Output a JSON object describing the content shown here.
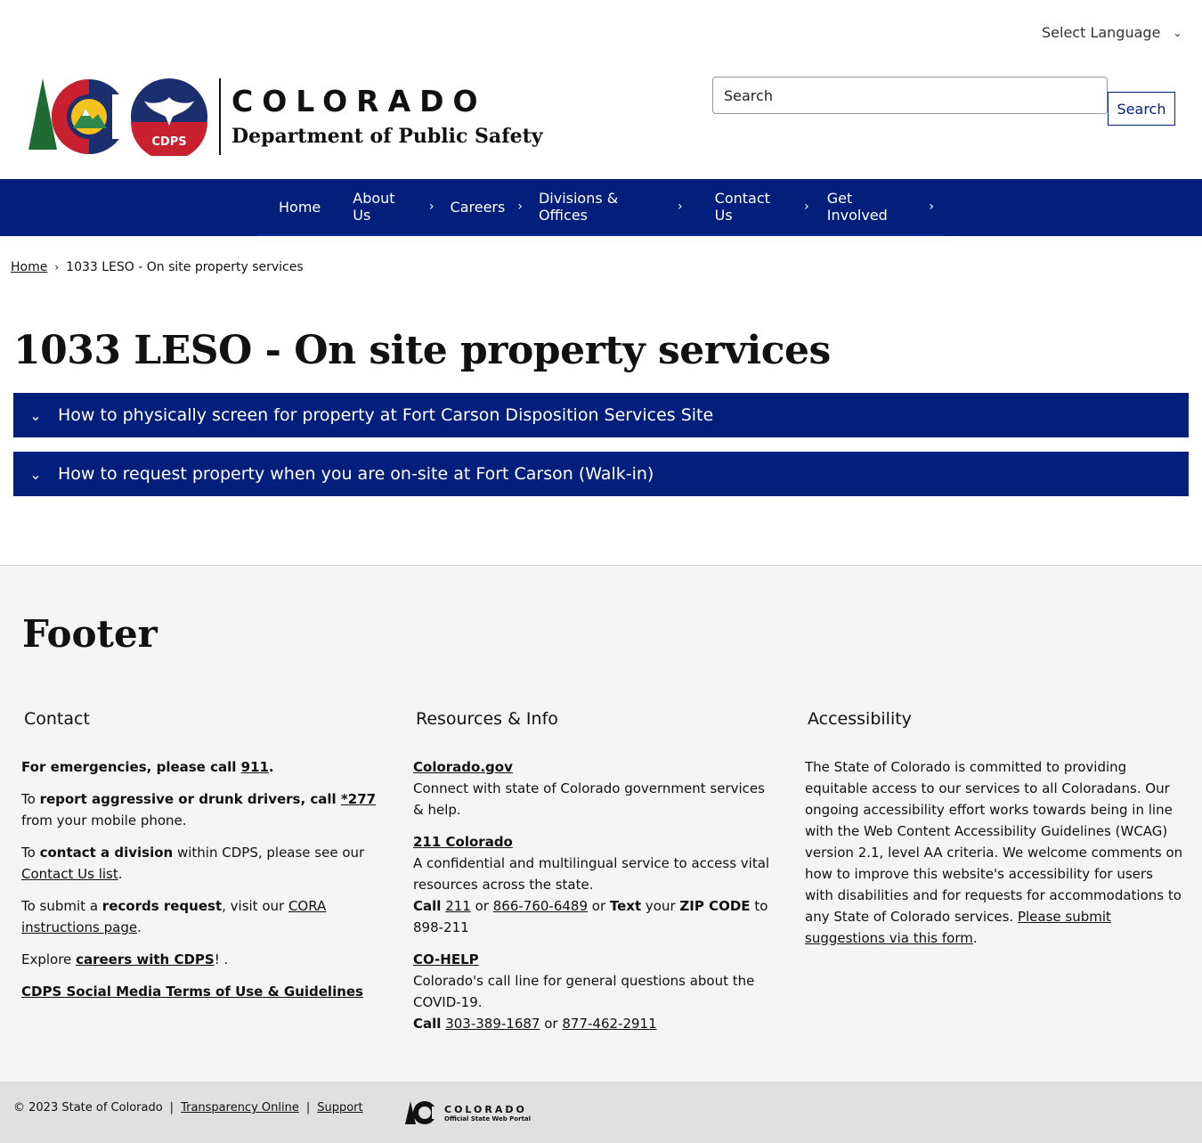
{
  "language": {
    "label": "Select Language"
  },
  "header": {
    "brand_top": "COLORADO",
    "brand_bottom": "Department of Public Safety",
    "seal_text": "CDPS",
    "search_placeholder": "Search",
    "search_button": "Search"
  },
  "nav": {
    "items": [
      {
        "label": "Home"
      },
      {
        "label": "About Us"
      },
      {
        "label": "Careers"
      },
      {
        "label": "Divisions & Offices"
      },
      {
        "label": "Contact Us"
      },
      {
        "label": "Get Involved"
      }
    ]
  },
  "breadcrumb": {
    "home": "Home",
    "current": "1033 LESO - On site property services"
  },
  "page": {
    "title": "1033 LESO - On site property services",
    "accordions": [
      {
        "label": "How to physically screen for property at Fort Carson Disposition Services Site"
      },
      {
        "label": "How to request property when you are on-site at Fort Carson (Walk-in)"
      }
    ]
  },
  "footer": {
    "heading": "Footer",
    "contact": {
      "heading": "Contact",
      "emergency_a": "For emergencies, please call ",
      "emergency_link": "911",
      "emergency_b": ".",
      "drivers_a": "To ",
      "drivers_bold": "report aggressive or drunk drivers, call ",
      "drivers_link": "*277",
      "drivers_b": " from your mobile phone.",
      "division_a": "To ",
      "division_bold": "contact a division",
      "division_b": " within CDPS, please see our ",
      "division_link": "Contact Us list",
      "division_c": ".",
      "records_a": "To submit a ",
      "records_bold": "records request",
      "records_b": ", visit our ",
      "records_link": "CORA instructions page",
      "records_c": ".",
      "careers_a": "Explore ",
      "careers_link": "careers with CDPS",
      "careers_b": "! .",
      "social_link": "CDPS Social Media Terms of Use & Guidelines"
    },
    "resources": {
      "heading": "Resources & Info",
      "co_link": "Colorado.gov",
      "co_desc": "Connect with state of Colorado government services & help.",
      "r211_link": "211 Colorado",
      "r211_desc": "A confidential and multilingual service to access vital resources across the state.",
      "r211_call": "Call",
      "r211_num1": "211",
      "r211_or1": " or ",
      "r211_num2": "866-760-6489",
      "r211_or2": " or ",
      "r211_text": "Text",
      "r211_your": " your ",
      "r211_zip": "ZIP CODE",
      "r211_to": " to 898-211",
      "cohelp_link": "CO-HELP",
      "cohelp_desc": "Colorado's call line for general questions about the COVID-19.",
      "cohelp_call": "Call",
      "cohelp_num1": "303-389-1687",
      "cohelp_or": " or ",
      "cohelp_num2": "877-462-2911"
    },
    "accessibility": {
      "heading": "Accessibility",
      "body": "The State of Colorado is committed to providing equitable access to our services to all Coloradans. Our ongoing accessibility effort works towards being in line with the Web Content Accessibility Guidelines (WCAG) version 2.1, level AA criteria. We welcome comments on how to improve this website's accessibility for users with disabilities and for requests for accommodations to any State of Colorado services. ",
      "link": "Please submit suggestions via this form",
      "end": "."
    }
  },
  "bottom": {
    "copyright": "© 2023 State of Colorado",
    "sep": "|",
    "transparency": "Transparency Online",
    "support": "Support",
    "portal_title": "COLORADO",
    "portal_sub": "Official State Web Portal"
  },
  "colors": {
    "navy": "#041E7B",
    "footer_bg": "#f4f4f4",
    "bottom_bg": "#e0e0e0"
  }
}
